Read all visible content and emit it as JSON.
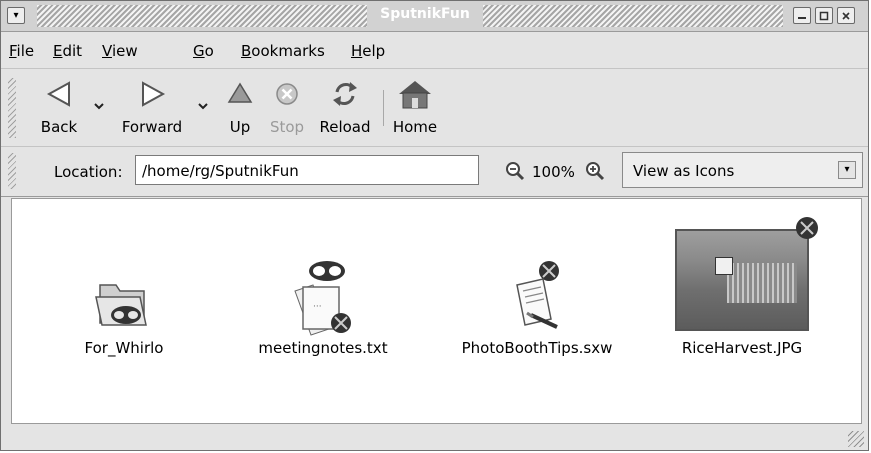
{
  "window": {
    "title": "SputnikFun"
  },
  "menubar": {
    "items": [
      {
        "label": "File",
        "accel": "F",
        "rest": "ile"
      },
      {
        "label": "Edit",
        "accel": "E",
        "rest": "dit"
      },
      {
        "label": "View",
        "accel": "V",
        "rest": "iew"
      },
      {
        "label": "Go",
        "accel": "G",
        "rest": "o"
      },
      {
        "label": "Bookmarks",
        "accel": "B",
        "rest": "ookmarks"
      },
      {
        "label": "Help",
        "accel": "H",
        "rest": "elp"
      }
    ]
  },
  "toolbar": {
    "back_label": "Back",
    "forward_label": "Forward",
    "up_label": "Up",
    "stop_label": "Stop",
    "reload_label": "Reload",
    "home_label": "Home"
  },
  "location": {
    "label": "Location:",
    "path": "/home/rg/SputnikFun",
    "zoom": "100%",
    "view_mode": "View as Icons"
  },
  "files": [
    {
      "name": "For_Whirlo",
      "icon": "folder-icon"
    },
    {
      "name": "meetingnotes.txt",
      "icon": "text-file-icon"
    },
    {
      "name": "PhotoBoothTips.sxw",
      "icon": "document-icon"
    },
    {
      "name": "RiceHarvest.JPG",
      "icon": "image-thumbnail"
    }
  ],
  "colors": {
    "window_bg": "#e4e4e4",
    "content_bg": "#ffffff",
    "title_text": "#ffffff"
  }
}
